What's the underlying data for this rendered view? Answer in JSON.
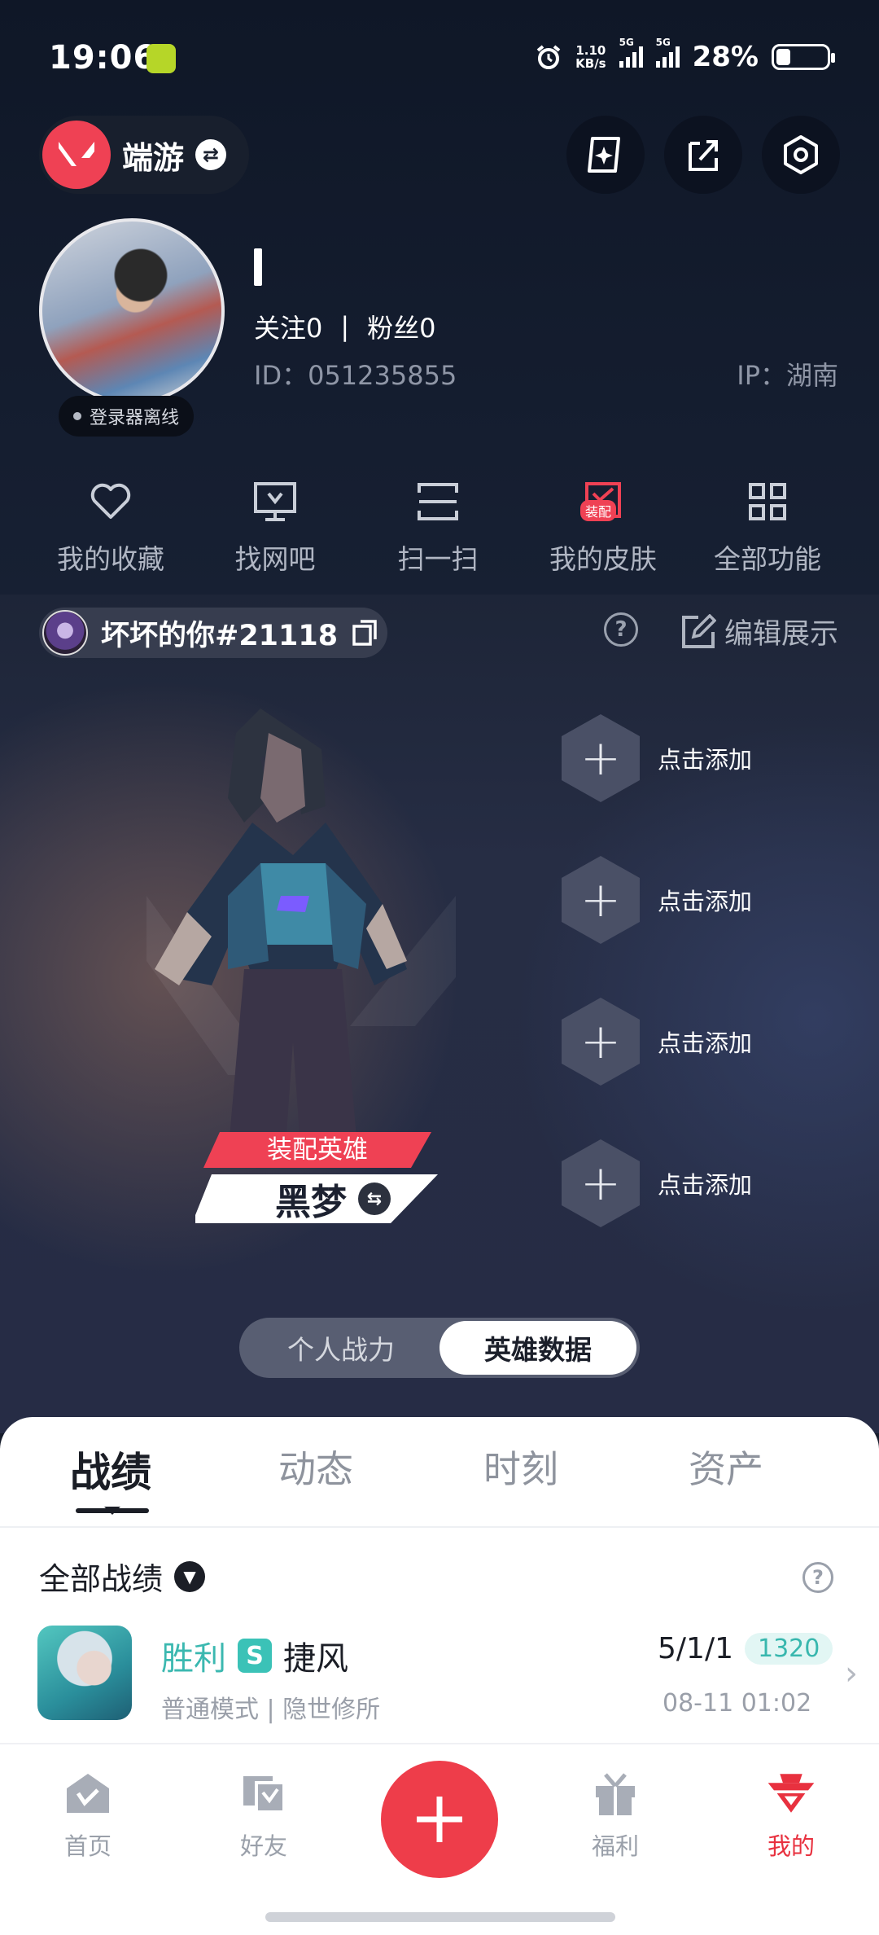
{
  "status_bar": {
    "time": "19:06",
    "net_speed_value": "1.10",
    "net_speed_unit": "KB/s",
    "signal_label_1": "5G",
    "signal_label_2": "5G",
    "battery": "28%",
    "battery_level": 0.28
  },
  "header": {
    "game_name": "端游"
  },
  "profile": {
    "online_status": "登录器离线",
    "following_label": "关注0",
    "separator": "|",
    "fans_label": "粉丝0",
    "id_text": "ID：051235855",
    "ip_text": "IP：湖南"
  },
  "features": [
    {
      "label": "我的收藏",
      "icon": "heart-icon"
    },
    {
      "label": "找网吧",
      "icon": "monitor-icon"
    },
    {
      "label": "扫一扫",
      "icon": "scan-icon"
    },
    {
      "label": "我的皮肤",
      "icon": "skin-icon",
      "badge": "装配"
    },
    {
      "label": "全部功能",
      "icon": "grid-icon"
    }
  ],
  "player": {
    "riot_id": "坏坏的你#21118",
    "edit_label": "编辑展示"
  },
  "hero": {
    "equip_label": "装配英雄",
    "equip_name": "黑梦"
  },
  "add_slots": [
    "点击添加",
    "点击添加",
    "点击添加",
    "点击添加"
  ],
  "toggle": {
    "options": [
      "个人战力",
      "英雄数据"
    ],
    "active": "英雄数据"
  },
  "tabs": [
    "战绩",
    "动态",
    "时刻",
    "资产"
  ],
  "filter_label": "全部战绩",
  "record": {
    "result": "胜利",
    "rank_badge": "S",
    "agent": "捷风",
    "mode": "普通模式 | 隐世修所",
    "kda": "5/1/1",
    "score": "1320",
    "time": "08-11 01:02"
  },
  "bottom_nav": [
    {
      "label": "首页",
      "icon": "home-icon"
    },
    {
      "label": "好友",
      "icon": "friends-icon"
    },
    {
      "label": "福利",
      "icon": "gift-icon"
    },
    {
      "label": "我的",
      "icon": "me-icon"
    }
  ],
  "colors": {
    "accent": "#ee3d4a",
    "win": "#3bb8b0"
  }
}
